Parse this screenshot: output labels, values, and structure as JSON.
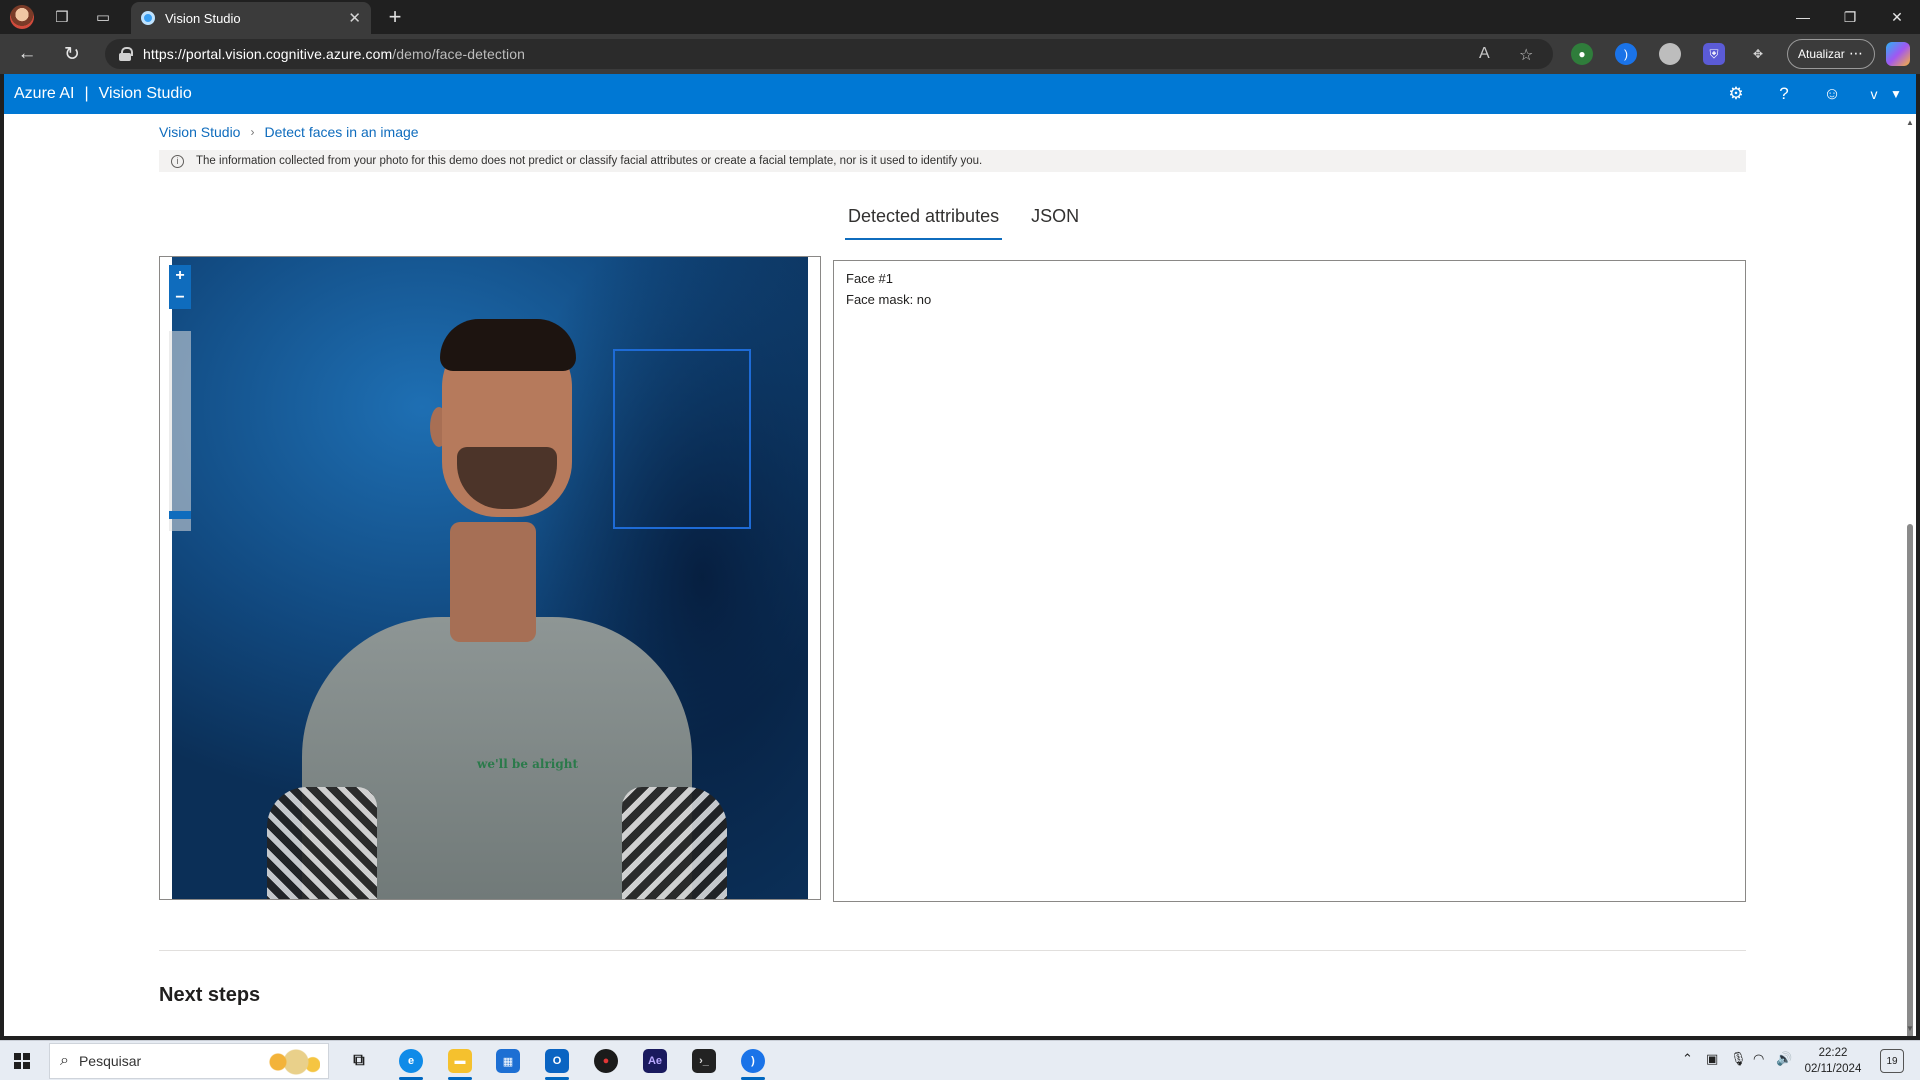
{
  "browser": {
    "tab_title": "Vision Studio",
    "url_host": "https://portal.vision.cognitive.azure.com",
    "url_path": "/demo/face-detection",
    "update_button": "Atualizar",
    "more_label": "⋯"
  },
  "app": {
    "brand": "Azure AI",
    "separator": "|",
    "product": "Vision Studio",
    "user_initial": "v"
  },
  "breadcrumb": {
    "home": "Vision Studio",
    "current": "Detect faces in an image"
  },
  "notice": {
    "text": "The information collected from your photo for this demo does not predict or classify facial attributes or create a facial template, nor is it used to identify you."
  },
  "tabs": [
    {
      "label": "Detected attributes",
      "active": true
    },
    {
      "label": "JSON",
      "active": false
    }
  ],
  "image_viewer": {
    "zoom_in": "+",
    "zoom_out": "−",
    "shirt_text": "we'll be alright",
    "zoom_level": 0.05
  },
  "attributes": {
    "face_label": "Face #1",
    "mask_label": "Face mask: no"
  },
  "section": {
    "next_steps": "Next steps"
  },
  "taskbar": {
    "search_placeholder": "Pesquisar",
    "time": "22:22",
    "date": "02/11/2024",
    "notifications": "19"
  },
  "colors": {
    "accent": "#0078d4",
    "link": "#0f6cbd",
    "face_box": "#1e6bd6"
  }
}
